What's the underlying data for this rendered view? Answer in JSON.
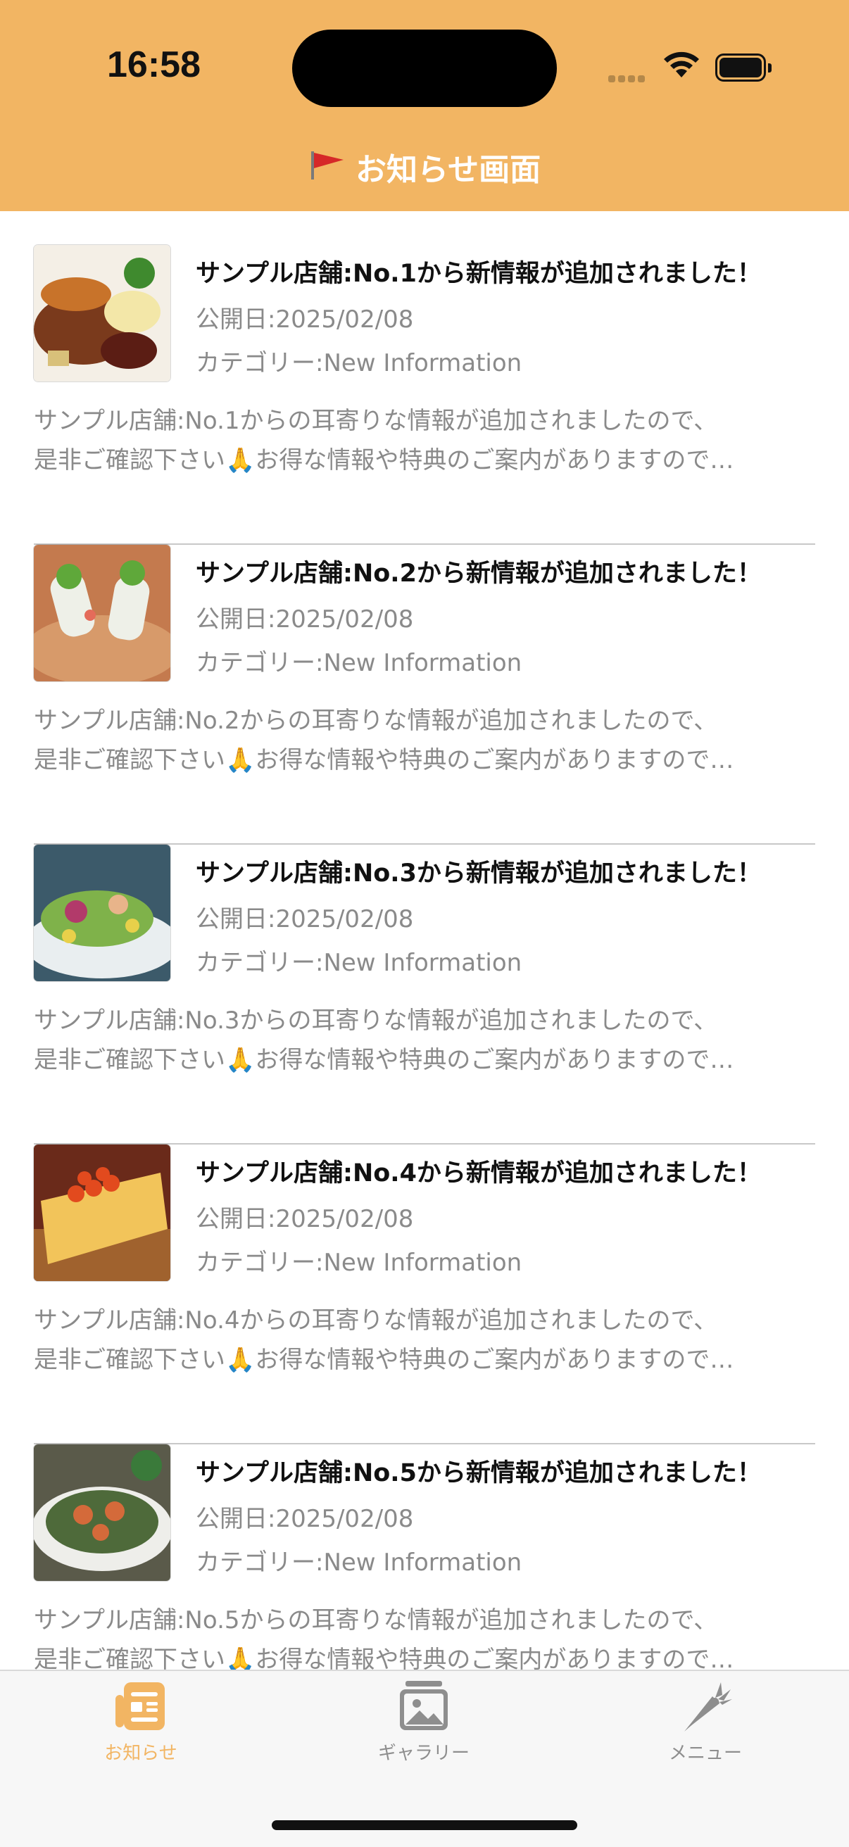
{
  "status_bar": {
    "time": "16:58"
  },
  "header": {
    "title": "お知らせ画面"
  },
  "news": [
    {
      "title": "サンプル店舗:No.1から新情報が追加されました！",
      "date": "公開日:2025/02/08",
      "category": "カテゴリー:New Information",
      "body_line1": "サンプル店舗:No.1からの耳寄りな情報が追加されましたので、",
      "body_line2": "是非ご確認下さい🙏お得な情報や特典のご案内がありますので…"
    },
    {
      "title": "サンプル店舗:No.2から新情報が追加されました！",
      "date": "公開日:2025/02/08",
      "category": "カテゴリー:New Information",
      "body_line1": "サンプル店舗:No.2からの耳寄りな情報が追加されましたので、",
      "body_line2": "是非ご確認下さい🙏お得な情報や特典のご案内がありますので…"
    },
    {
      "title": "サンプル店舗:No.3から新情報が追加されました！",
      "date": "公開日:2025/02/08",
      "category": "カテゴリー:New Information",
      "body_line1": "サンプル店舗:No.3からの耳寄りな情報が追加されましたので、",
      "body_line2": "是非ご確認下さい🙏お得な情報や特典のご案内がありますので…"
    },
    {
      "title": "サンプル店舗:No.4から新情報が追加されました！",
      "date": "公開日:2025/02/08",
      "category": "カテゴリー:New Information",
      "body_line1": "サンプル店舗:No.4からの耳寄りな情報が追加されましたので、",
      "body_line2": "是非ご確認下さい🙏お得な情報や特典のご案内がありますので…"
    },
    {
      "title": "サンプル店舗:No.5から新情報が追加されました！",
      "date": "公開日:2025/02/08",
      "category": "カテゴリー:New Information",
      "body_line1": "サンプル店舗:No.5からの耳寄りな情報が追加されましたので、",
      "body_line2": "是非ご確認下さい🙏お得な情報や特典のご案内がありますので…"
    }
  ],
  "tabbar": {
    "tabs": [
      {
        "label": "お知らせ",
        "icon": "news-list-icon",
        "active": true
      },
      {
        "label": "ギャラリー",
        "icon": "gallery-photo-icon",
        "active": false
      },
      {
        "label": "メニュー",
        "icon": "carrot-icon",
        "active": false
      }
    ]
  },
  "colors": {
    "header_bg": "#F2B563",
    "tab_active": "#F2B563",
    "tab_inactive": "#8e8e8e",
    "secondary_text": "#8a8a8a"
  }
}
